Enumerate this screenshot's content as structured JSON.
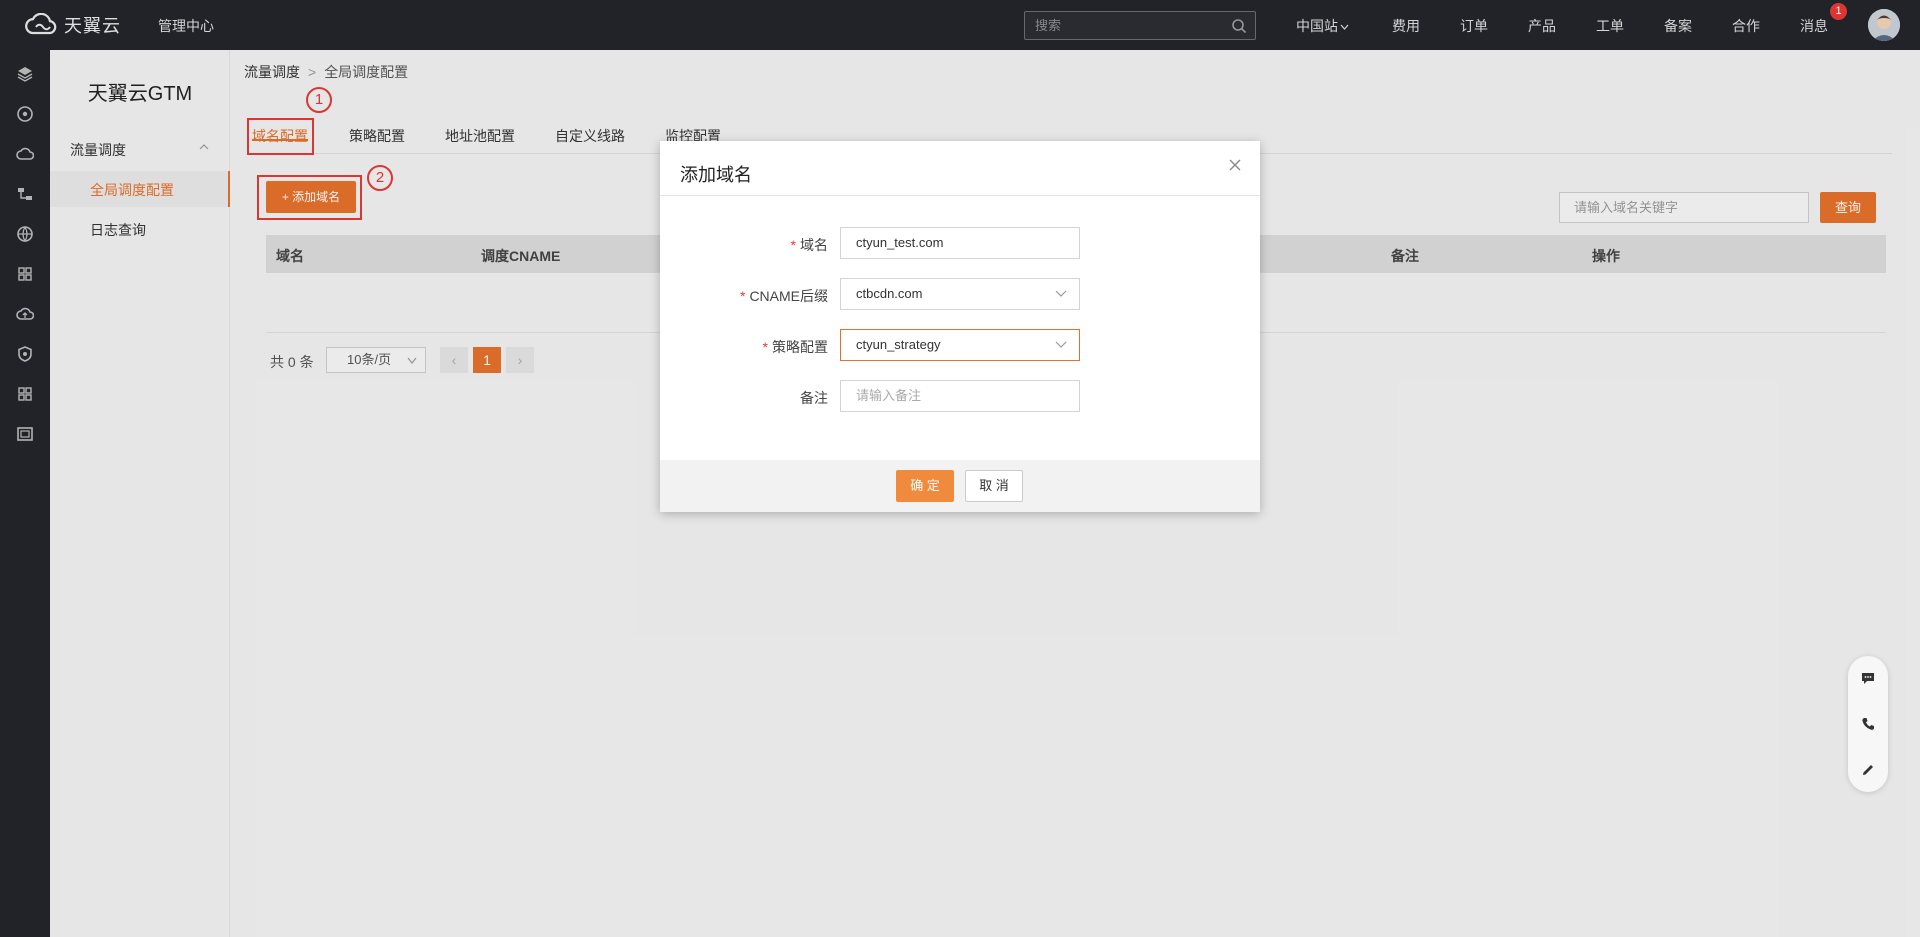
{
  "header": {
    "brand": "天翼云",
    "mgmt_center": "管理中心",
    "search_placeholder": "搜索",
    "nav": [
      "中国站",
      "费用",
      "订单",
      "产品",
      "工单",
      "备案",
      "合作",
      "消息"
    ],
    "msg_count": "1"
  },
  "sidebar": {
    "product_title": "天翼云GTM",
    "group_label": "流量调度",
    "items": [
      "全局调度配置",
      "日志查询"
    ]
  },
  "breadcrumb": {
    "parent": "流量调度",
    "current": "全局调度配置"
  },
  "tabs": [
    "域名配置",
    "策略配置",
    "地址池配置",
    "自定义线路",
    "监控配置"
  ],
  "toolbar": {
    "add_label": "+ 添加域名",
    "filter_placeholder": "请输入域名关键字",
    "query_label": "查询"
  },
  "table": {
    "headers": [
      "域名",
      "调度CNAME",
      "备注",
      "操作"
    ]
  },
  "pager": {
    "total": "共 0 条",
    "page_size": "10条/页",
    "current_page": "1",
    "prev": "‹",
    "next": "›"
  },
  "annotations": [
    "1",
    "2"
  ],
  "modal": {
    "title": "添加域名",
    "fields": [
      {
        "label": "域名",
        "required": true,
        "value": "ctyun_test.com"
      },
      {
        "label": "CNAME后缀",
        "required": true,
        "value": "ctbcdn.com"
      },
      {
        "label": "策略配置",
        "required": true,
        "value": "ctyun_strategy"
      },
      {
        "label": "备注",
        "required": false,
        "placeholder": "请输入备注"
      }
    ],
    "ok_label": "确 定",
    "cancel_label": "取 消"
  },
  "colors": {
    "accent": "#e4702a",
    "topbar": "#23252b",
    "annotation": "#e53935"
  }
}
